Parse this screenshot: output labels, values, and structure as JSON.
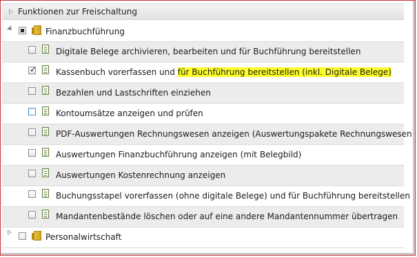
{
  "panel": {
    "title": "Funktionen zur Freischaltung"
  },
  "groups": [
    {
      "label": "Finanzbuchführung",
      "expanded": true,
      "checkbox": "partial"
    },
    {
      "label": "Personalwirtschaft",
      "expanded": false,
      "checkbox": "unchecked"
    }
  ],
  "items": [
    {
      "label": "Digitale Belege archivieren, bearbeiten und für Buchführung bereitstellen",
      "checked": false
    },
    {
      "label_plain": "Kassenbuch vorerfassen und",
      "label_highlight": "für Buchführung bereitstellen (inkl. Digitale Belege)",
      "checked": true
    },
    {
      "label": "Bezahlen und Lastschriften einziehen",
      "checked": false
    },
    {
      "label": "Kontoumsätze anzeigen und prüfen",
      "checked": false,
      "focused": true
    },
    {
      "label": "PDF-Auswertungen Rechnungswesen anzeigen (Auswertungspakete Rechnungswesen)",
      "checked": false
    },
    {
      "label": "Auswertungen Finanzbuchführung anzeigen (mit Belegbild)",
      "checked": false
    },
    {
      "label": "Auswertungen Kostenrechnung anzeigen",
      "checked": false
    },
    {
      "label": "Buchungsstapel vorerfassen (ohne digitale Belege) und für Buchführung bereitstellen",
      "checked": false
    },
    {
      "label": "Mandantenbestände löschen oder auf eine andere Mandantennummer übertragen",
      "checked": false
    }
  ],
  "colors": {
    "highlight": "#fdfd2a",
    "frame_border": "#c8323c",
    "focus_checkbox": "#3b8ad0"
  }
}
